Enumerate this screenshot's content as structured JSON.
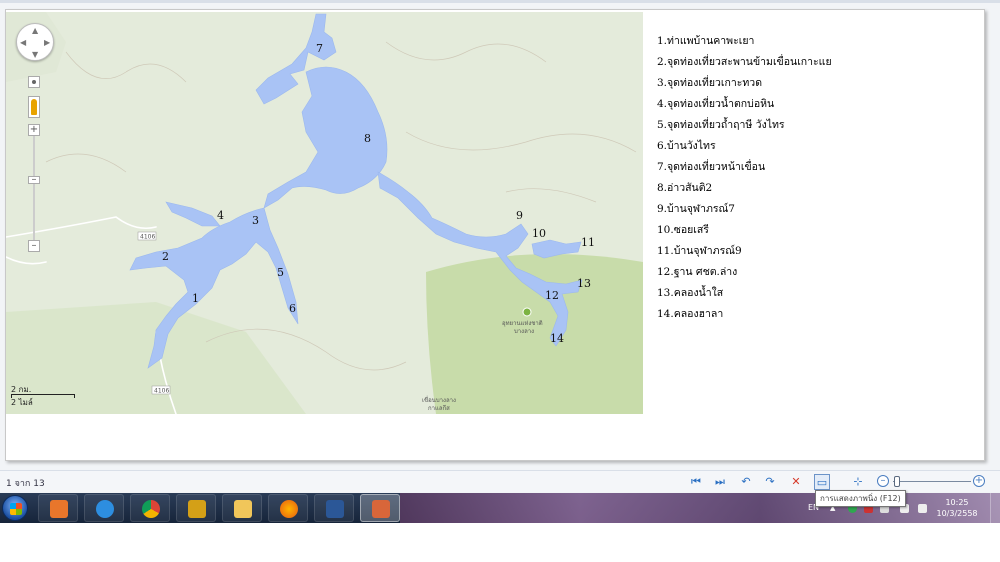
{
  "map": {
    "road_labels": [
      "4106",
      "4106"
    ],
    "park_label_line1": "อุทยานแห่งชาติ",
    "park_label_line2": "บางลาง",
    "bottom_label_line1": "เขื่อนบางลาง",
    "bottom_label_line2": "กาแลกีส",
    "numbers": [
      "1",
      "2",
      "3",
      "4",
      "5",
      "6",
      "7",
      "8",
      "9",
      "10",
      "11",
      "12",
      "13",
      "14"
    ],
    "scale_km": "2 กม.",
    "scale_mi": "2 ไมล์",
    "colors": {
      "water": "#a9c3f5",
      "land": "#e3eada",
      "forest": "#c5dca9",
      "road": "#ffffff"
    }
  },
  "legend": [
    "1.ท่าแพบ้านคาพะเยา",
    "2.จุดท่องเที่ยวสะพานข้ามเขื่อนเกาะแย",
    "3.จุดท่องเที่ยวเกาะทวด",
    "4.จุดท่องเที่ยวน้ำตกบ่อหิน",
    "5.จุดท่องเที่ยวถ้ำฤาษี วังไทร",
    "6.บ้านวังไทร",
    "7.จุดท่องเที่ยวหน้าเขื่อน",
    "8.อ่าวสันติ2",
    "9.บ้านจุฬาภรณ์7",
    "10.ซอยเสรี",
    "11.บ้านจุฬาภรณ์9",
    "12.ฐาน ศชต.ล่าง",
    "13.คลองน้ำใส",
    "14.คลองฮาลา"
  ],
  "viewer": {
    "page_info": "1 จาก 13",
    "tooltip": "การแสดงภาพนิ่ง (F12)",
    "tools": [
      "first-page-icon",
      "last-page-icon",
      "rotate-left-icon",
      "rotate-right-icon",
      "delete-icon",
      "slideshow-icon",
      "fit-window-icon"
    ]
  },
  "taskbar": {
    "language": "EN",
    "time": "10:25",
    "date": "10/3/2558"
  }
}
